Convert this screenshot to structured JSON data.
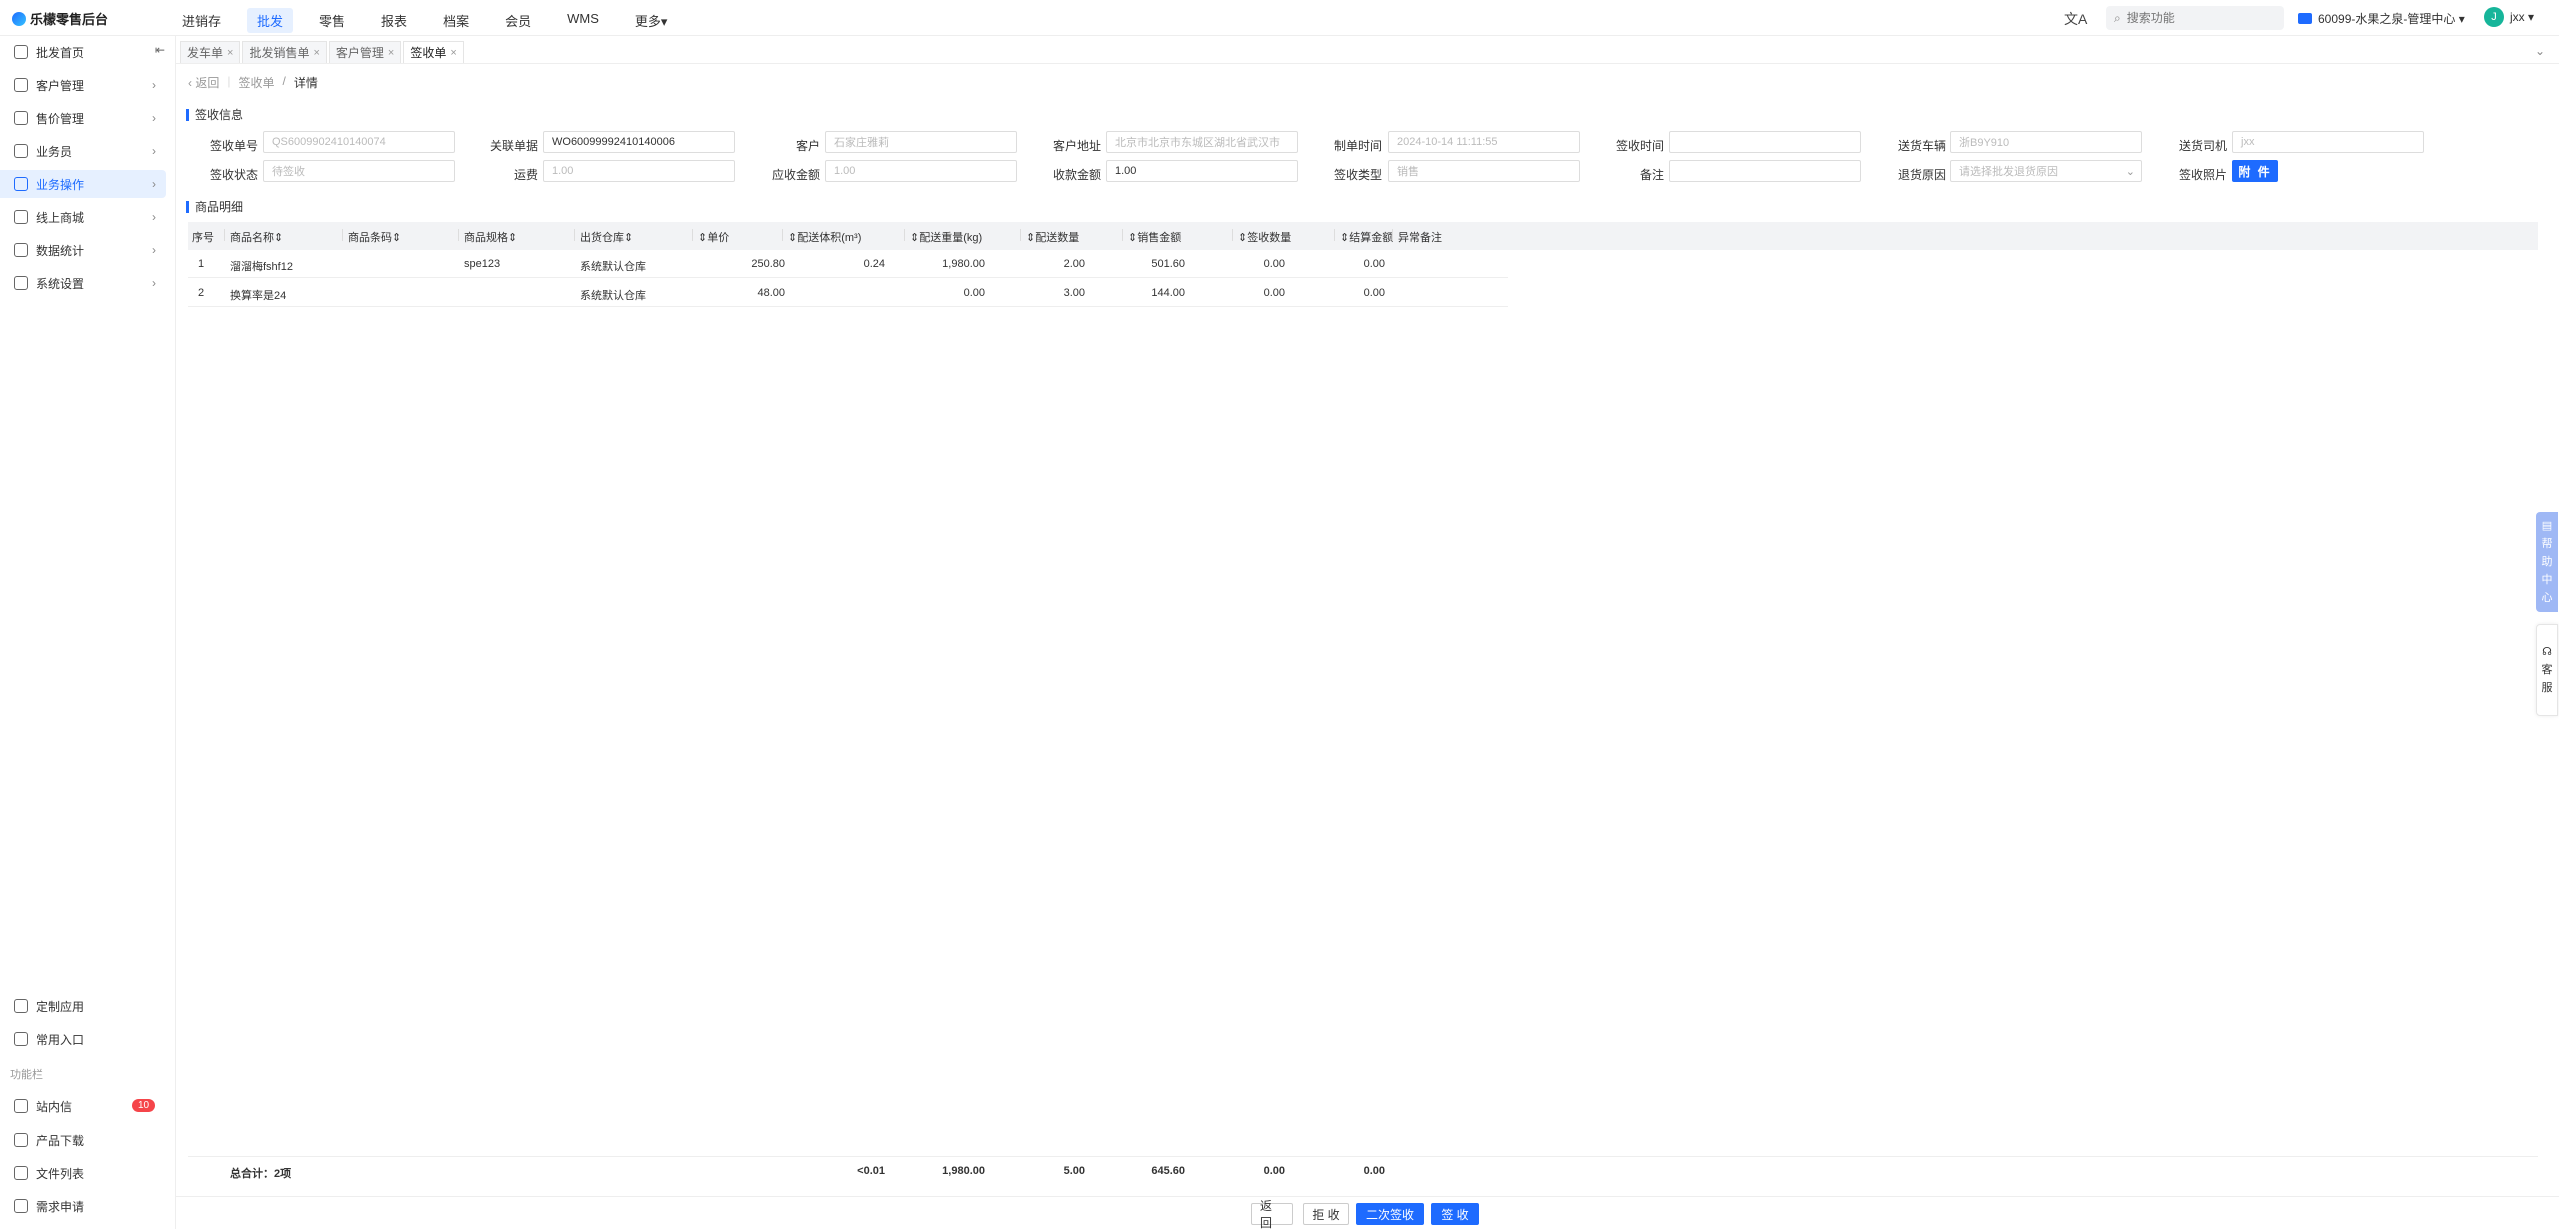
{
  "app": {
    "title": "乐檬零售后台"
  },
  "topnav": [
    {
      "label": "进销存",
      "active": false
    },
    {
      "label": "批发",
      "active": true
    },
    {
      "label": "零售",
      "active": false
    },
    {
      "label": "报表",
      "active": false
    },
    {
      "label": "档案",
      "active": false
    },
    {
      "label": "会员",
      "active": false
    },
    {
      "label": "WMS",
      "active": false
    },
    {
      "label": "更多▾",
      "active": false
    }
  ],
  "search": {
    "placeholder": "搜索功能"
  },
  "store": {
    "label": "60099-水果之泉-管理中心 ▾"
  },
  "user": {
    "avatar": "J",
    "name": "jxx ▾"
  },
  "sidebar": {
    "collapse_icon": "⇤",
    "items": [
      {
        "label": "批发首页",
        "icon": "home-icon"
      },
      {
        "label": "客户管理",
        "icon": "customer-icon"
      },
      {
        "label": "售价管理",
        "icon": "price-icon"
      },
      {
        "label": "业务员",
        "icon": "salesman-icon"
      },
      {
        "label": "业务操作",
        "icon": "operation-icon",
        "active": true
      },
      {
        "label": "线上商城",
        "icon": "mall-icon"
      },
      {
        "label": "数据统计",
        "icon": "stats-icon"
      },
      {
        "label": "系统设置",
        "icon": "settings-icon"
      }
    ],
    "bottom_items": [
      {
        "label": "定制应用",
        "icon": "custom-app-icon"
      },
      {
        "label": "常用入口",
        "icon": "heart-icon"
      }
    ],
    "section_label": "功能栏",
    "function_items": [
      {
        "label": "站内信",
        "icon": "mail-icon",
        "badge": "10"
      },
      {
        "label": "产品下载",
        "icon": "download-icon"
      },
      {
        "label": "文件列表",
        "icon": "file-list-icon"
      },
      {
        "label": "需求申请",
        "icon": "request-icon"
      }
    ]
  },
  "tabs": [
    {
      "label": "发车单",
      "active": false
    },
    {
      "label": "批发销售单",
      "active": false
    },
    {
      "label": "客户管理",
      "active": false
    },
    {
      "label": "签收单",
      "active": true
    }
  ],
  "breadcrumb": {
    "back": "返回",
    "parent": "签收单",
    "sep": "/",
    "current": "详情"
  },
  "sections": {
    "sign_info": "签收信息",
    "goods_detail": "商品明细"
  },
  "form": {
    "sign_no": {
      "label": "签收单号",
      "value": "QS60099024101400​74"
    },
    "related_no": {
      "label": "关联单据",
      "value": "WO60099992410140006"
    },
    "customer": {
      "label": "客户",
      "value": "石家庄雅莉"
    },
    "address": {
      "label": "客户地址",
      "value": "北京市北京市东城区湖北省武汉市"
    },
    "create_time": {
      "label": "制单时间",
      "value": "2024-10-14 11:11:55"
    },
    "sign_time": {
      "label": "签收时间",
      "value": ""
    },
    "vehicle": {
      "label": "送货车辆",
      "value": "浙B9Y910"
    },
    "driver": {
      "label": "送货司机",
      "value": "jxx"
    },
    "status": {
      "label": "签收状态",
      "value": "待签收"
    },
    "freight": {
      "label": "运费",
      "value": "1.00"
    },
    "receivable": {
      "label": "应收金额",
      "value": "1.00"
    },
    "received": {
      "label": "收款金额",
      "value": "1.00"
    },
    "sign_type": {
      "label": "签收类型",
      "value": "销售"
    },
    "remark": {
      "label": "备注",
      "value": ""
    },
    "return_reason": {
      "label": "退货原因",
      "placeholder": "请选择批发退货原因"
    },
    "photo": {
      "label": "签收照片",
      "button": "附 件"
    }
  },
  "table": {
    "headers": [
      "序号",
      "商品名称⇕",
      "商品条码⇕",
      "商品规格⇕",
      "出货仓库⇕",
      "⇕单价",
      "⇕配送体积(m³)",
      "⇕配送重量(kg)",
      "⇕配送数量",
      "⇕销售金额",
      "⇕签收数量",
      "⇕结算金额",
      "异常备注"
    ],
    "rows": [
      [
        "1",
        "溜溜梅fshf12",
        "",
        "spe123",
        "系统默认仓库",
        "250.80",
        "0.24",
        "1,980.00",
        "2.00",
        "501.60",
        "0.00",
        "0.00",
        ""
      ],
      [
        "2",
        "换算率是24",
        "",
        "",
        "系统默认仓库",
        "48.00",
        "",
        "0.00",
        "3.00",
        "144.00",
        "0.00",
        "0.00",
        ""
      ]
    ],
    "footer": [
      "总合计：2项",
      "<0.01",
      "1,980.00",
      "5.00",
      "645.60",
      "0.00",
      "0.00"
    ]
  },
  "buttons": {
    "back": "返 回",
    "reject": "拒 收",
    "second_sign": "二次签收",
    "sign": "签 收"
  },
  "float": {
    "help": [
      "帮",
      "助",
      "中",
      "心"
    ],
    "service": [
      "客",
      "服"
    ],
    "help_icon": "▤",
    "service_icon": "☊"
  },
  "colors": {
    "accent": "#1e6bff",
    "badge": "#f5454a"
  }
}
